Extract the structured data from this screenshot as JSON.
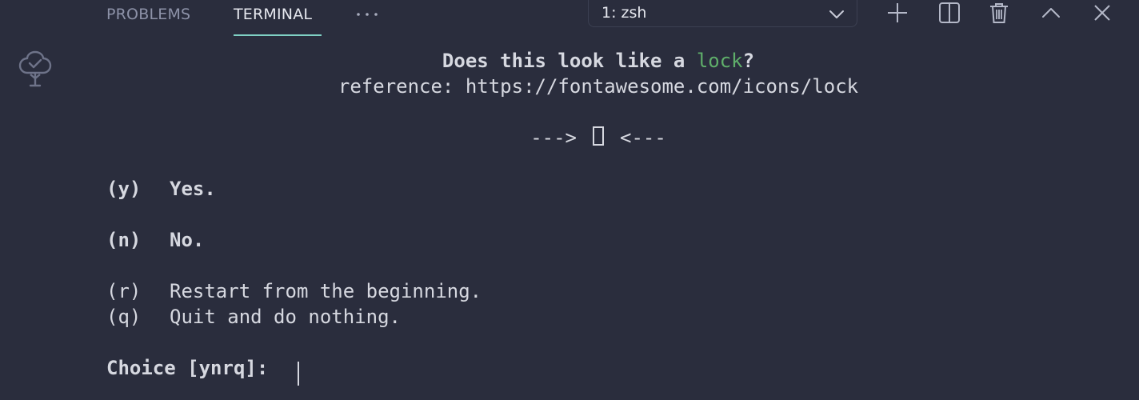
{
  "panel": {
    "tabs": {
      "problems": "PROBLEMS",
      "terminal": "TERMINAL"
    },
    "more_label": "···",
    "terminal_selector": {
      "value": "1: zsh"
    },
    "actions": [
      "plus-icon",
      "split-icon",
      "trash-icon",
      "chevron-up-icon",
      "close-icon"
    ]
  },
  "side": {
    "icon": "tree-check-icon"
  },
  "terminal": {
    "question_prefix": "Does this look like a ",
    "question_keyword": "lock",
    "question_suffix": "?",
    "reference": "reference: https://fontawesome.com/icons/lock",
    "arrow_left": "--->",
    "arrow_right": "<---",
    "options": {
      "y": {
        "key": "(y)",
        "label": "Yes."
      },
      "n": {
        "key": "(n)",
        "label": "No."
      },
      "r": {
        "key": "(r)",
        "label": "Restart from the beginning."
      },
      "q": {
        "key": "(q)",
        "label": "Quit and do nothing."
      }
    },
    "prompt": "Choice [ynrq]: "
  },
  "colors": {
    "background": "#2a2d3d",
    "tab_active_underline": "#7fd0c4",
    "keyword": "#5fae6a",
    "text": "#d6d8e0",
    "muted": "#8d92a8"
  }
}
